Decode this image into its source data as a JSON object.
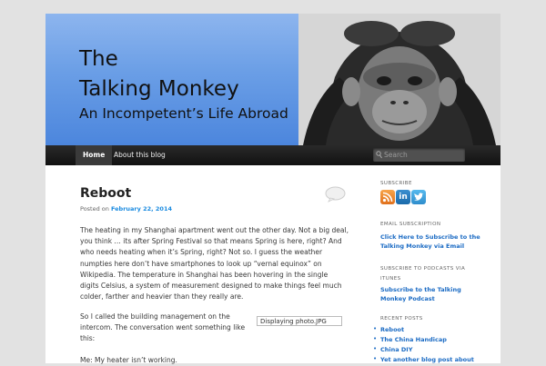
{
  "header": {
    "title_line1": "The",
    "title_line2": "Talking Monkey",
    "tagline": "An Incompetent’s Life Abroad"
  },
  "nav": {
    "items": [
      {
        "label": "Home"
      },
      {
        "label": "About this blog"
      }
    ],
    "search_placeholder": "Search"
  },
  "post": {
    "title": "Reboot",
    "posted_on_prefix": "Posted on",
    "date": "February 22, 2014",
    "paragraph1": "The heating in my Shanghai apartment went out the other day.  Not a big deal, you think … its after Spring Festival so that means Spring is here, right?  And who needs heating when it’s Spring, right?  Not so. I guess the weather numpties here don’t have smartphones to look up “vernal equinox” on Wikipedia. The temperature in Shanghai has been hovering in the single digits Celsius, a system of measurement designed to make things feel much colder, farther and heavier than they really are.",
    "paragraph2": "So I called the building management on the intercom. The conversation went something like this:",
    "image_caption": "Displaying photo.JPG",
    "paragraph3": "Me: My heater isn’t working."
  },
  "sidebar": {
    "subscribe_heading": "SUBSCRIBE",
    "icons": [
      "rss-icon",
      "linkedin-icon",
      "twitter-icon"
    ],
    "email_heading": "EMAIL SUBSCRIPTION",
    "email_link": "Click Here to Subscribe to the Talking Monkey via Email",
    "podcast_heading": "SUBSCRIBE TO PODCASTS VIA ITUNES",
    "podcast_link": "Subscribe to the Talking Monkey Podcast",
    "recent_heading": "RECENT POSTS",
    "recent_posts": [
      "Reboot",
      "The China Handicap",
      "China DIY",
      "Yet another blog post about"
    ]
  },
  "colors": {
    "header_blue": "#6a9ee6",
    "navbar": "#1c1c1c",
    "link_blue": "#1b6bc4",
    "rss_orange": "#f28b2c"
  }
}
